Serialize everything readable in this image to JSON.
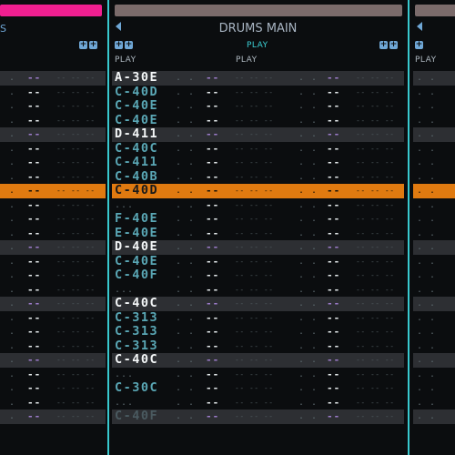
{
  "colors": {
    "background": "#0b0d0f",
    "separator": "#38c9cf",
    "active_track_bar": "#f01f90",
    "track_bar": "#7b6b6b",
    "highlight_row": "#e07a10",
    "accent_row": "#2d2f33",
    "note_text": "#5aa7b5",
    "note_bright": "#f4f7f8",
    "volume_dash": "#9b7bc8",
    "play_label": "#3cd0d6"
  },
  "tracks": {
    "left": {
      "title": "S",
      "plus_minus": [
        "+",
        "+"
      ]
    },
    "main": {
      "title": "DRUMS MAIN",
      "plus_minus_left": [
        "+",
        "+"
      ],
      "plus_minus_right": [
        "+",
        "+"
      ],
      "column_labels": [
        "PLAY",
        "PLAY"
      ],
      "header_play": "PLAY"
    },
    "right": {
      "plus_minus": [
        "+"
      ],
      "column_label": "PLAY"
    }
  },
  "pattern": {
    "rows": [
      {
        "style": "accent",
        "note": "A-30E",
        "tone": "bright"
      },
      {
        "style": "normal",
        "note": "C-40D",
        "tone": "normal"
      },
      {
        "style": "normal",
        "note": "C-40E",
        "tone": "normal"
      },
      {
        "style": "normal",
        "note": "C-40E",
        "tone": "normal"
      },
      {
        "style": "accent",
        "note": "D-411",
        "tone": "bright"
      },
      {
        "style": "normal",
        "note": "C-40C",
        "tone": "normal"
      },
      {
        "style": "normal",
        "note": "C-411",
        "tone": "normal"
      },
      {
        "style": "normal",
        "note": "C-40B",
        "tone": "normal"
      },
      {
        "style": "highlight",
        "note": "C-40D",
        "tone": "dark"
      },
      {
        "style": "normal",
        "note": "",
        "tone": "normal"
      },
      {
        "style": "normal",
        "note": "F-40E",
        "tone": "normal"
      },
      {
        "style": "normal",
        "note": "E-40E",
        "tone": "normal"
      },
      {
        "style": "accent",
        "note": "D-40E",
        "tone": "bright"
      },
      {
        "style": "normal",
        "note": "C-40E",
        "tone": "normal"
      },
      {
        "style": "normal",
        "note": "C-40F",
        "tone": "normal"
      },
      {
        "style": "normal",
        "note": "",
        "tone": "normal"
      },
      {
        "style": "accent",
        "note": "C-40C",
        "tone": "bright"
      },
      {
        "style": "normal",
        "note": "C-313",
        "tone": "normal"
      },
      {
        "style": "normal",
        "note": "C-313",
        "tone": "normal"
      },
      {
        "style": "normal",
        "note": "C-313",
        "tone": "normal"
      },
      {
        "style": "accent",
        "note": "C-40C",
        "tone": "bright"
      },
      {
        "style": "normal",
        "note": "",
        "tone": "normal"
      },
      {
        "style": "normal",
        "note": "C-30C",
        "tone": "normal"
      },
      {
        "style": "normal",
        "note": "",
        "tone": "normal"
      },
      {
        "style": "accent",
        "note": "C-40F",
        "tone": "faded"
      }
    ],
    "empty_fill": {
      "dash": "--",
      "dots": ". .",
      "fx": "-- -- --"
    }
  }
}
